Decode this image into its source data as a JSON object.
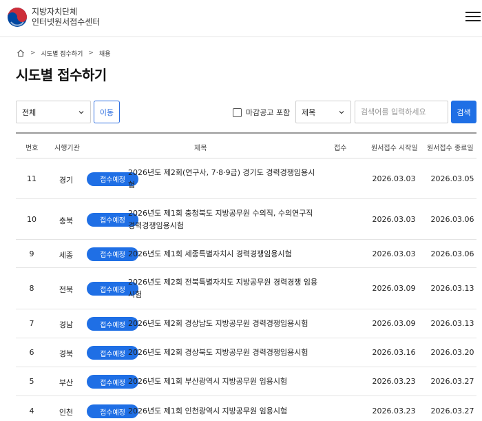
{
  "header": {
    "org_line1": "지방자치단체",
    "org_line2": "인터넷원서접수센터"
  },
  "breadcrumb": {
    "items": [
      "시도별 접수하기",
      "채용"
    ]
  },
  "page_title": "시도별 접수하기",
  "filters": {
    "region_select": "전체",
    "move_label": "이동",
    "include_closed_label": "마감공고 포함",
    "include_closed_checked": false,
    "field_select": "제목",
    "search_placeholder": "검색어를 입력하세요",
    "search_label": "검색"
  },
  "table": {
    "headers": {
      "no": "번호",
      "org": "시행기관",
      "title": "제목",
      "status": "접수",
      "start": "원서접수 시작일",
      "end": "원서접수 종료일"
    },
    "rows": [
      {
        "no": "11",
        "org": "경기",
        "badge": "접수예정",
        "title": "2026년도 제2회(연구사, 7·8·9급) 경기도 경력경쟁임용시험",
        "start": "2026.03.03",
        "end": "2026.03.05"
      },
      {
        "no": "10",
        "org": "충북",
        "badge": "접수예정",
        "title": "2026년도 제1회 충청북도 지방공무원 수의직, 수의연구직 경력경쟁임용시험",
        "start": "2026.03.03",
        "end": "2026.03.06"
      },
      {
        "no": "9",
        "org": "세종",
        "badge": "접수예정",
        "title": "2026년도 제1회 세종특별자치시 경력경쟁임용시험",
        "start": "2026.03.03",
        "end": "2026.03.06"
      },
      {
        "no": "8",
        "org": "전북",
        "badge": "접수예정",
        "title": "2026년도 제2회 전북특별자치도 지방공무원 경력경쟁 임용시험",
        "start": "2026.03.09",
        "end": "2026.03.13"
      },
      {
        "no": "7",
        "org": "경남",
        "badge": "접수예정",
        "title": "2026년도 제2회 경상남도 지방공무원 경력경쟁임용시험",
        "start": "2026.03.09",
        "end": "2026.03.13"
      },
      {
        "no": "6",
        "org": "경북",
        "badge": "접수예정",
        "title": "2026년도 제2회 경상북도 지방공무원 경력경쟁임용시험",
        "start": "2026.03.16",
        "end": "2026.03.20"
      },
      {
        "no": "5",
        "org": "부산",
        "badge": "접수예정",
        "title": "2026년도 제1회 부산광역시 지방공무원 임용시험",
        "start": "2026.03.23",
        "end": "2026.03.27"
      },
      {
        "no": "4",
        "org": "인천",
        "badge": "접수예정",
        "title": "2026년도 제1회 인천광역시 지방공무원 임용시험",
        "start": "2026.03.23",
        "end": "2026.03.27"
      }
    ]
  },
  "colors": {
    "accent": "#1f6fe5",
    "logo_red": "#cd2e3a",
    "logo_blue": "#0047a0"
  },
  "icons": [
    "taegeuk-logo-icon",
    "menu-icon",
    "home-icon",
    "chevron-right-icon",
    "chevron-down-icon"
  ]
}
